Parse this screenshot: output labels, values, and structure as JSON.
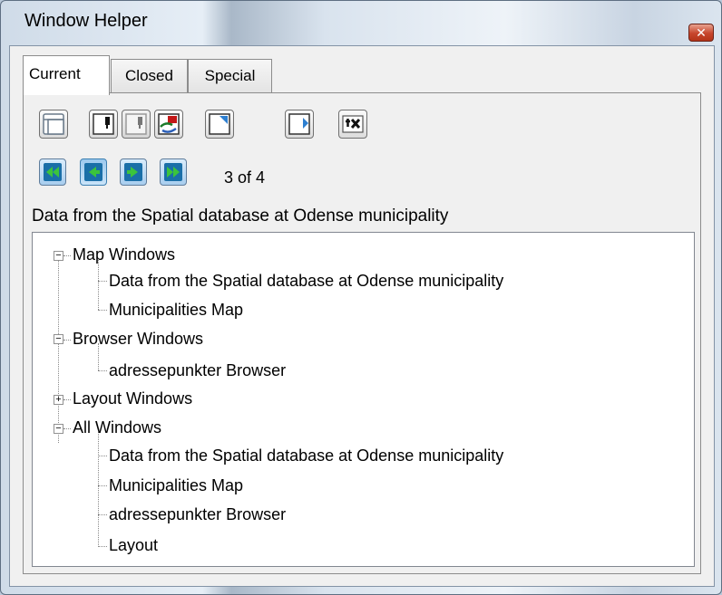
{
  "window": {
    "title": "Window Helper",
    "close_glyph": "✕"
  },
  "tabs": [
    {
      "label": "Current",
      "active": true
    },
    {
      "label": "Closed",
      "active": false
    },
    {
      "label": "Special",
      "active": false
    }
  ],
  "toolbar": {
    "icons": [
      "cascade-icon",
      "pin-window-icon",
      "pin-window-disabled-icon",
      "swap-windows-icon",
      "restore-window-icon",
      "maximize-window-icon",
      "close-window-x-icon"
    ],
    "close_glyph": "ꟷ✕"
  },
  "navigation": {
    "icons": [
      "first-icon",
      "previous-icon",
      "next-icon",
      "last-icon"
    ],
    "counter": "3 of 4"
  },
  "active_window_title": "Data from the Spatial database at Odense municipality",
  "tree": {
    "map_windows": {
      "label": "Map Windows",
      "expanded": true,
      "children": [
        "Data from the Spatial database at Odense municipality",
        "Municipalities Map"
      ]
    },
    "browser_windows": {
      "label": "Browser Windows",
      "expanded": true,
      "children": [
        "adressepunkter Browser"
      ]
    },
    "layout_windows": {
      "label": "Layout Windows",
      "expanded": false,
      "children": []
    },
    "all_windows": {
      "label": "All Windows",
      "expanded": true,
      "children": [
        "Data from the Spatial database at Odense municipality",
        "Municipalities Map",
        "adressepunkter Browser",
        "Layout"
      ]
    }
  },
  "colors": {
    "accent": "#3c7fb1",
    "close_button": "#c7452c"
  }
}
